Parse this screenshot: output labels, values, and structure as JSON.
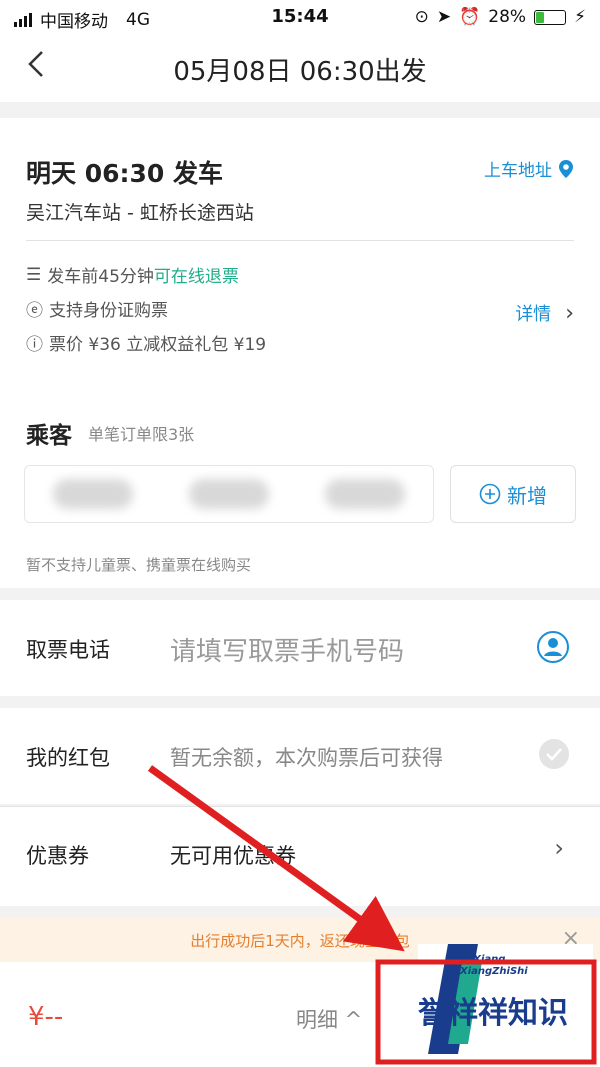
{
  "status_bar": {
    "carrier": "中国移动",
    "network": "4G",
    "time": "15:44",
    "battery": "28%",
    "battery_level": 0.28
  },
  "nav": {
    "title": "05月08日 06:30出发"
  },
  "trip": {
    "depart_time": "明天 06:30 发车",
    "stations": "吴江汽车站 - 虹桥长途西站",
    "boarding_address": "上车地址",
    "refund_prefix": "发车前45分钟",
    "refund_highlight": "可在线退票",
    "id_support": "支持身份证购票",
    "price_info": "票价 ¥36 立减权益礼包 ¥19",
    "detail_link": "详情"
  },
  "passenger": {
    "title": "乘客",
    "limit": "单笔订单限3张",
    "add_label": "新增",
    "note": "暂不支持儿童票、携童票在线购买"
  },
  "phone": {
    "label": "取票电话",
    "placeholder": "请填写取票手机号码"
  },
  "red_packet": {
    "label": "我的红包",
    "value": "暂无余额，本次购票后可获得"
  },
  "coupon": {
    "label": "优惠券",
    "value": "无可用优惠券"
  },
  "banner": {
    "text": "出行成功后1天内，返还现金红包"
  },
  "bottom": {
    "price": "¥--",
    "detail": "明细 ^"
  },
  "watermark": {
    "brand": "誉祥祥知识",
    "latin_line1": "YuXiang",
    "latin_line2": "XiangZhiShi"
  },
  "colors": {
    "accent": "#1a8fd5",
    "green": "#1fae89",
    "price_red": "#e84a3a",
    "banner_orange": "#e57f2d",
    "annotation_red": "#e02020"
  }
}
